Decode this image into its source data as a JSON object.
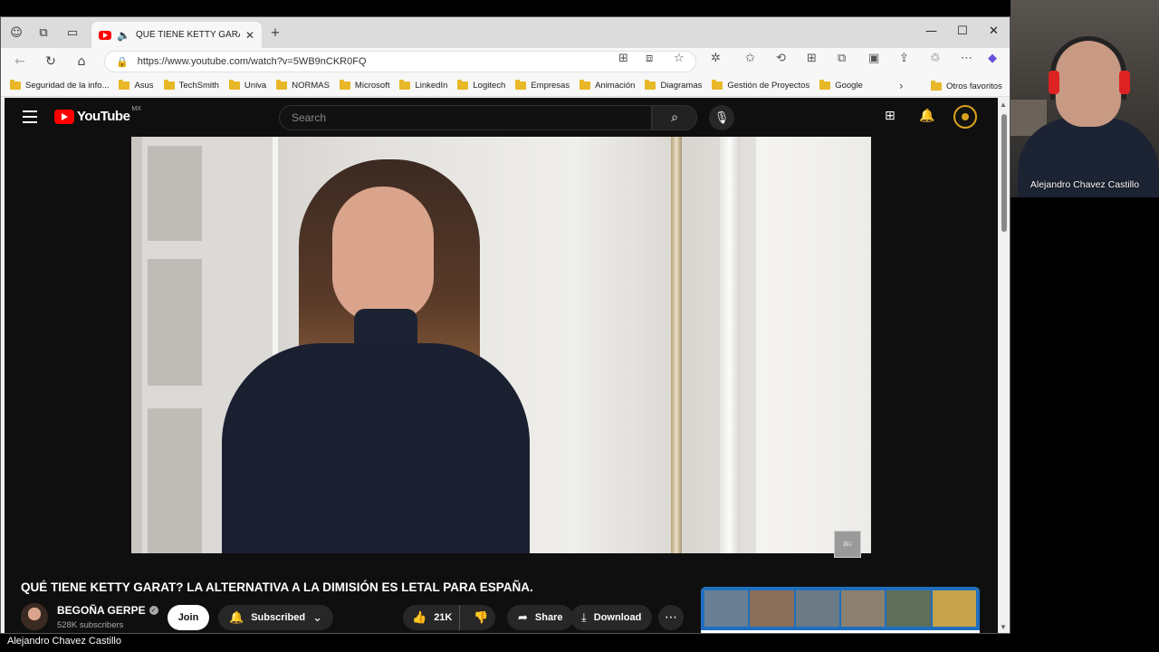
{
  "browser": {
    "tab": {
      "title": "QUÉ TIENE KETTY GARAT? LA ALTERNATIVA A LA DIMISIÓN ES LETAL PARA ESPAÑA. - YouTube"
    },
    "address": {
      "url": "https://www.youtube.com/watch?v=5WB9nCKR0FQ"
    },
    "bookmarks": [
      "Seguridad de la info...",
      "Asus",
      "TechSmith",
      "Univa",
      "NORMAS",
      "Microsoft",
      "LinkedIn",
      "Logitech",
      "Empresas",
      "Animación",
      "Diagramas",
      "Gestión de Proyectos",
      "Google"
    ],
    "other_bookmarks": "Otros favoritos"
  },
  "youtube": {
    "logo_text": "YouTube",
    "region": "MX",
    "search_placeholder": "Search",
    "video": {
      "title": "QUÉ TIENE KETTY GARAT? LA ALTERNATIVA A LA DIMISIÓN ES LETAL PARA ESPAÑA.",
      "watermark": "BG"
    },
    "channel": {
      "name": "BEGOÑA GERPE",
      "subscribers": "528K subscribers"
    },
    "actions": {
      "join": "Join",
      "subscribed": "Subscribed",
      "likes": "21K",
      "share": "Share",
      "download": "Download"
    }
  },
  "webcam": {
    "name": "Alejandro Chavez Castillo"
  },
  "footer": {
    "name": "Alejandro Chavez Castillo"
  },
  "colors": {
    "youtube_red": "#ff0000",
    "accent_gold": "#d9a21b",
    "folder": "#e8b829"
  }
}
